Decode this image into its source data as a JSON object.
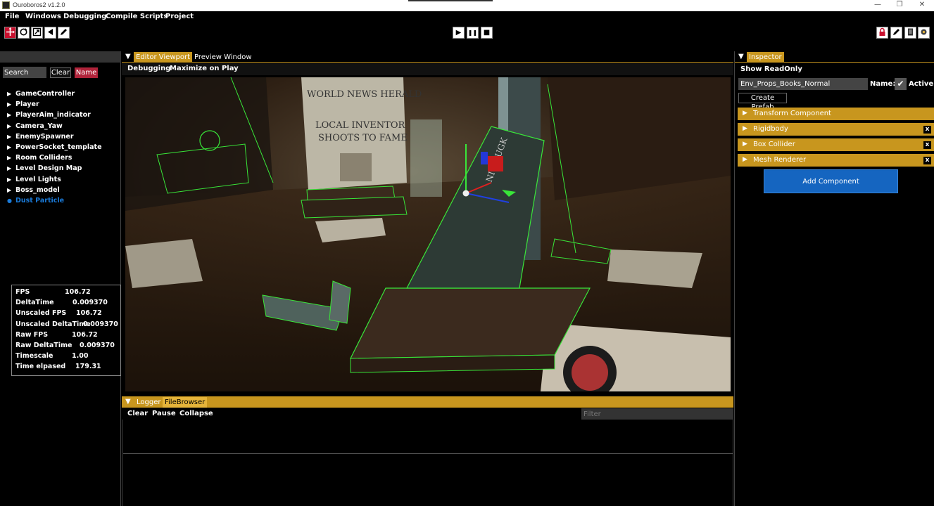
{
  "window": {
    "title": "Ouroboros2 v1.2.0",
    "minimize": "—",
    "restore": "❐",
    "close": "✕"
  },
  "menu": [
    "File",
    "Windows",
    "Debugging",
    "Compile Scripts",
    "Project"
  ],
  "toolbar": {
    "left_icons": [
      "move-gizmo-icon",
      "rotate-icon",
      "scale-icon",
      "undo-icon",
      "pencil-icon"
    ],
    "center_icons": [
      "play-icon",
      "pause-icon",
      "stop-icon"
    ],
    "right_icons": [
      "lock-icon",
      "pencil-icon",
      "file-icon",
      "settings-icon"
    ],
    "play": "▶",
    "pause": "❚❚",
    "stop": "■"
  },
  "hierarchy": {
    "search_placeholder": "Search",
    "clear_label": "Clear",
    "name_label": "Name",
    "items": [
      {
        "label": "GameController",
        "marker": "▶"
      },
      {
        "label": "Player",
        "marker": "▶"
      },
      {
        "label": "PlayerAim_indicator",
        "marker": "▶"
      },
      {
        "label": "Camera_Yaw",
        "marker": "▶"
      },
      {
        "label": "EnemySpawner",
        "marker": "▶"
      },
      {
        "label": "PowerSocket_template",
        "marker": "▶"
      },
      {
        "label": "Room Colliders",
        "marker": "▶"
      },
      {
        "label": "Level Design Map",
        "marker": "▶"
      },
      {
        "label": "Level Lights",
        "marker": "▶"
      },
      {
        "label": "Boss_model",
        "marker": "▶"
      },
      {
        "label": "Dust Particle",
        "marker": "●"
      }
    ]
  },
  "stats": [
    {
      "label": "FPS",
      "value": "106.72"
    },
    {
      "label": "DeltaTime",
      "value": "0.009370"
    },
    {
      "label": "Unscaled FPS",
      "value": "106.72"
    },
    {
      "label": "Unscaled DeltaTime",
      "value": "0.009370"
    },
    {
      "label": "Raw FPS",
      "value": "106.72"
    },
    {
      "label": "Raw DeltaTime",
      "value": "0.009370"
    },
    {
      "label": "Timescale",
      "value": "1.00"
    },
    {
      "label": "Time elpased",
      "value": "179.31"
    }
  ],
  "center": {
    "tabs": [
      "Editor Viewport",
      "Preview Window"
    ],
    "menu": [
      "Debugging",
      "Maximize on Play"
    ]
  },
  "viewport": {
    "poster_title": "WORLD NEWS HERALD",
    "poster_headline_1": "LOCAL INVENTOR",
    "poster_headline_2": "SHOOTS TO FAME",
    "book_text": "NIT HUGK"
  },
  "logger": {
    "tabs": [
      "Logger",
      "FileBrowser"
    ],
    "menu": [
      "Clear",
      "Pause",
      "Collapse"
    ],
    "filter_placeholder": "Filter"
  },
  "inspector": {
    "tab": "Inspector",
    "show_readonly": "Show ReadOnly",
    "entity_name": "Env_Props_Books_Normal",
    "name_label": "Name:",
    "active_label": "Active",
    "create_prefab": "Create Prefab",
    "remove_glyph": "x",
    "components": [
      {
        "label": "Transform Component",
        "removable": false
      },
      {
        "label": "Rigidbody",
        "removable": true
      },
      {
        "label": "Box Collider",
        "removable": true
      },
      {
        "label": "Mesh Renderer",
        "removable": true
      }
    ],
    "add_component": "Add Component"
  },
  "colors": {
    "accent": "#c8961e",
    "selected": "#1a7ad8",
    "danger": "#b0233a",
    "primary_button": "#1565c0",
    "wireframe": "#39e639"
  }
}
